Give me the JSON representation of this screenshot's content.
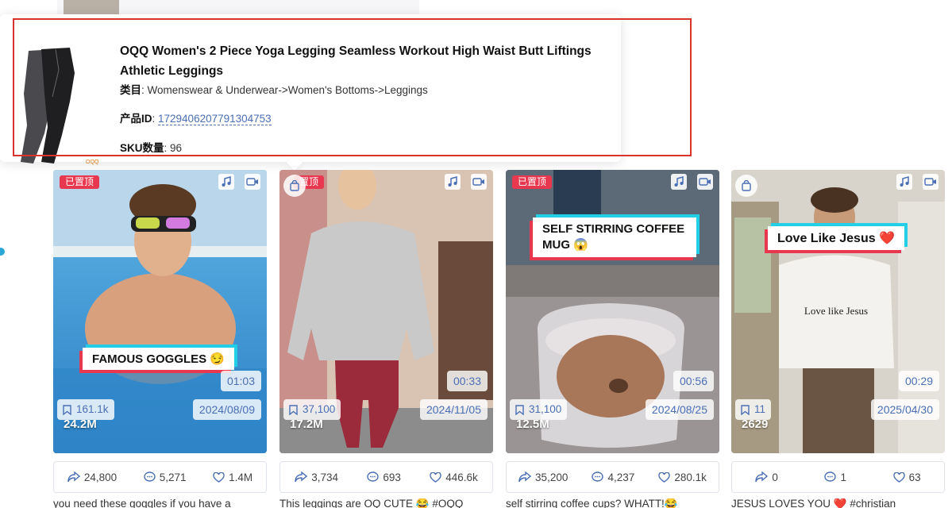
{
  "product": {
    "title": "OQQ Women's 2 Piece Yoga Legging Seamless Workout High Waist Butt Liftings Athletic Leggings",
    "category_label": "类目",
    "category_value": "Womenswear & Underwear->Women's Bottoms->Leggings",
    "id_label": "产品ID",
    "id_value": "1729406207791304753",
    "sku_label": "SKU数量",
    "sku_value": "96",
    "brand_mark": "OQQ"
  },
  "cards": [
    {
      "pinned_label": "已置顶",
      "caption": "FAMOUS GOGGLES 😏",
      "duration": "01:03",
      "saves": "161.1k",
      "date": "2024/08/09",
      "views": "24.2M",
      "shares": "24,800",
      "comments": "5,271",
      "likes": "1.4M",
      "desc": "you need these goggles if you have a"
    },
    {
      "pinned_label": "置顶",
      "caption": "",
      "duration": "00:33",
      "saves": "37,100",
      "date": "2024/11/05",
      "views": "17.2M",
      "shares": "3,734",
      "comments": "693",
      "likes": "446.6k",
      "desc": "This leggings are OQ CUTE 😂 #OQQ"
    },
    {
      "pinned_label": "已置顶",
      "caption": "SELF STIRRING COFFEE MUG 😱",
      "duration": "00:56",
      "saves": "31,100",
      "date": "2024/08/25",
      "views": "12.5M",
      "shares": "35,200",
      "comments": "4,237",
      "likes": "280.1k",
      "desc": "self stirring coffee cups? WHATT!😂"
    },
    {
      "pinned_label": "",
      "caption": "Love Like Jesus ❤️",
      "shirt_text": "Love like Jesus",
      "duration": "00:29",
      "saves": "11",
      "date": "2025/04/30",
      "views": "2629",
      "shares": "0",
      "comments": "1",
      "likes": "63",
      "desc": "JESUS LOVES YOU ❤️ #christian"
    }
  ],
  "colors": {
    "accent": "#4a6fb5",
    "highlight_border": "#d9342c",
    "pinned": "#e8384f",
    "caption_cyan": "#22cfe6"
  }
}
